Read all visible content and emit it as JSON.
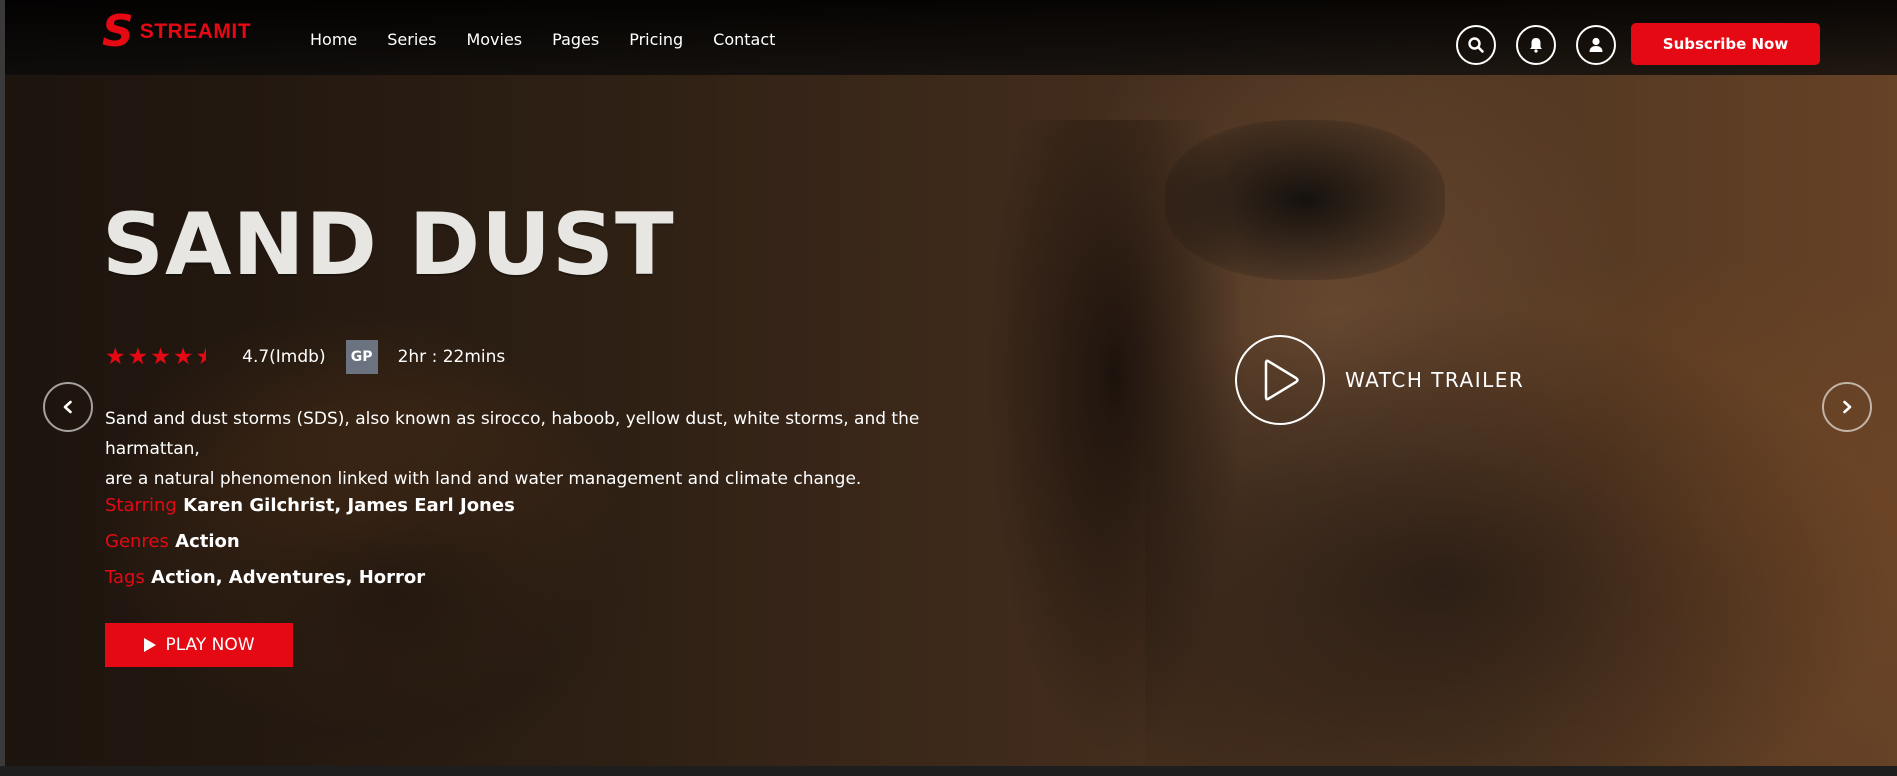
{
  "header": {
    "logo_mark": "S",
    "logo_text": "STREAMIT",
    "nav": [
      "Home",
      "Series",
      "Movies",
      "Pages",
      "Pricing",
      "Contact"
    ],
    "icons": [
      "search-icon",
      "bell-icon",
      "user-icon"
    ],
    "subscribe_label": "Subscribe Now"
  },
  "hero": {
    "title": "SAND DUST",
    "rating_stars": 4.5,
    "rating_text": "4.7(Imdb)",
    "badge": "GP",
    "runtime": "2hr : 22mins",
    "description_line1": "Sand and dust storms (SDS), also known as sirocco, haboob, yellow dust, white storms, and the harmattan,",
    "description_line2": "are a natural phenomenon linked with land and water management and climate change.",
    "starring_label": "Starring",
    "starring_value": "Karen Gilchrist, James Earl Jones",
    "genres_label": "Genres",
    "genres_value": "Action",
    "tags_label": "Tags",
    "tags_value": "Action, Adventures, Horror",
    "play_label": "PLAY NOW",
    "trailer_label": "WATCH TRAILER"
  },
  "colors": {
    "accent": "#e50914",
    "badge": "#6b7280"
  }
}
